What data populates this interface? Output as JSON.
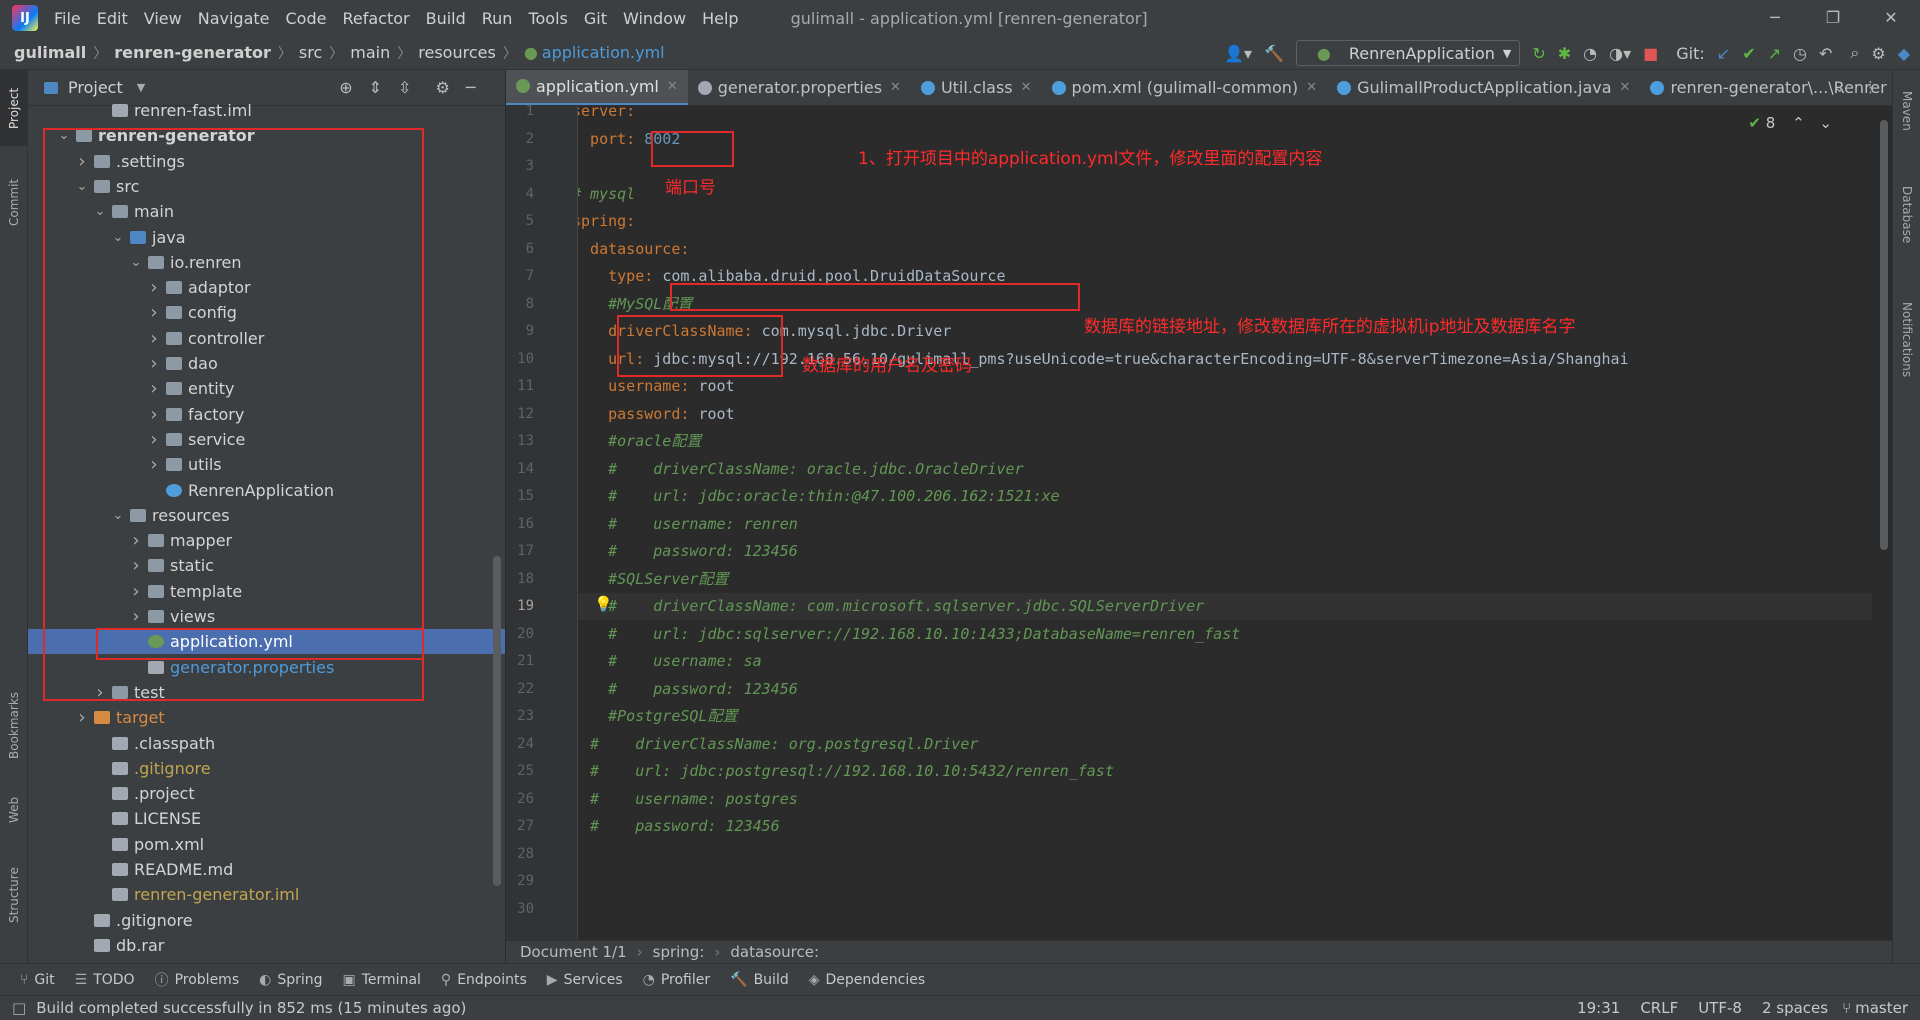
{
  "app": {
    "menu": [
      "File",
      "Edit",
      "View",
      "Navigate",
      "Code",
      "Refactor",
      "Build",
      "Run",
      "Tools",
      "Git",
      "Window",
      "Help"
    ],
    "title": "gulimall - application.yml [renren-generator]"
  },
  "breadcrumb": [
    "gulimall",
    "renren-generator",
    "src",
    "main",
    "resources",
    "application.yml"
  ],
  "toolbar": {
    "run_config": "RenrenApplication",
    "git_label": "Git:"
  },
  "left_strip": [
    "Project",
    "Commit",
    "Bookmarks",
    "Web",
    "Structure"
  ],
  "right_strip": [
    "Maven",
    "Database",
    "Notifications"
  ],
  "project_panel": {
    "title": "Project",
    "tree": [
      {
        "label": "renren-fast.iml",
        "indent": 3,
        "arrow": "",
        "icon": "file",
        "style": ""
      },
      {
        "label": "renren-generator",
        "indent": 1,
        "arrow": "v",
        "icon": "folder",
        "style": "bold"
      },
      {
        "label": ".settings",
        "indent": 2,
        "arrow": ">",
        "icon": "folder",
        "style": ""
      },
      {
        "label": "src",
        "indent": 2,
        "arrow": "v",
        "icon": "folder",
        "style": ""
      },
      {
        "label": "main",
        "indent": 3,
        "arrow": "v",
        "icon": "folder",
        "style": ""
      },
      {
        "label": "java",
        "indent": 4,
        "arrow": "v",
        "icon": "folder-blue",
        "style": ""
      },
      {
        "label": "io.renren",
        "indent": 5,
        "arrow": "v",
        "icon": "folder",
        "style": ""
      },
      {
        "label": "adaptor",
        "indent": 6,
        "arrow": ">",
        "icon": "folder",
        "style": ""
      },
      {
        "label": "config",
        "indent": 6,
        "arrow": ">",
        "icon": "folder",
        "style": ""
      },
      {
        "label": "controller",
        "indent": 6,
        "arrow": ">",
        "icon": "folder",
        "style": ""
      },
      {
        "label": "dao",
        "indent": 6,
        "arrow": ">",
        "icon": "folder",
        "style": ""
      },
      {
        "label": "entity",
        "indent": 6,
        "arrow": ">",
        "icon": "folder",
        "style": ""
      },
      {
        "label": "factory",
        "indent": 6,
        "arrow": ">",
        "icon": "folder",
        "style": ""
      },
      {
        "label": "service",
        "indent": 6,
        "arrow": ">",
        "icon": "folder",
        "style": ""
      },
      {
        "label": "utils",
        "indent": 6,
        "arrow": ">",
        "icon": "folder",
        "style": ""
      },
      {
        "label": "RenrenApplication",
        "indent": 6,
        "arrow": "",
        "icon": "class",
        "style": ""
      },
      {
        "label": "resources",
        "indent": 4,
        "arrow": "v",
        "icon": "folder",
        "style": ""
      },
      {
        "label": "mapper",
        "indent": 5,
        "arrow": ">",
        "icon": "folder",
        "style": ""
      },
      {
        "label": "static",
        "indent": 5,
        "arrow": ">",
        "icon": "folder",
        "style": ""
      },
      {
        "label": "template",
        "indent": 5,
        "arrow": ">",
        "icon": "folder",
        "style": ""
      },
      {
        "label": "views",
        "indent": 5,
        "arrow": ">",
        "icon": "folder",
        "style": ""
      },
      {
        "label": "application.yml",
        "indent": 5,
        "arrow": "",
        "icon": "leaf",
        "style": "selected"
      },
      {
        "label": "generator.properties",
        "indent": 5,
        "arrow": "",
        "icon": "file",
        "style": "blue"
      },
      {
        "label": "test",
        "indent": 3,
        "arrow": ">",
        "icon": "folder",
        "style": ""
      },
      {
        "label": "target",
        "indent": 2,
        "arrow": ">",
        "icon": "folder-orange",
        "style": "orange"
      },
      {
        "label": ".classpath",
        "indent": 3,
        "arrow": "",
        "icon": "file",
        "style": ""
      },
      {
        "label": ".gitignore",
        "indent": 3,
        "arrow": "",
        "icon": "file",
        "style": "yellow"
      },
      {
        "label": ".project",
        "indent": 3,
        "arrow": "",
        "icon": "file",
        "style": ""
      },
      {
        "label": "LICENSE",
        "indent": 3,
        "arrow": "",
        "icon": "file",
        "style": ""
      },
      {
        "label": "pom.xml",
        "indent": 3,
        "arrow": "",
        "icon": "maven",
        "style": ""
      },
      {
        "label": "README.md",
        "indent": 3,
        "arrow": "",
        "icon": "file",
        "style": ""
      },
      {
        "label": "renren-generator.iml",
        "indent": 3,
        "arrow": "",
        "icon": "file",
        "style": "yellow"
      },
      {
        "label": ".gitignore",
        "indent": 2,
        "arrow": "",
        "icon": "file",
        "style": ""
      },
      {
        "label": "db.rar",
        "indent": 2,
        "arrow": "",
        "icon": "file",
        "style": ""
      }
    ]
  },
  "tabs": [
    {
      "label": "application.yml",
      "active": true,
      "icon": "#6a9955"
    },
    {
      "label": "generator.properties",
      "active": false,
      "icon": "#a2a9b3"
    },
    {
      "label": "Util.class",
      "active": false,
      "icon": "#4e9edc"
    },
    {
      "label": "pom.xml (gulimall-common)",
      "active": false,
      "icon": "#4e9edc"
    },
    {
      "label": "GulimallProductApplication.java",
      "active": false,
      "icon": "#4e9edc"
    },
    {
      "label": "renren-generator\\...\\Renrer",
      "active": false,
      "icon": "#4e9edc"
    }
  ],
  "editor": {
    "inspection_count": "8",
    "lines": [
      [
        [
          "k",
          "server:"
        ]
      ],
      [
        [
          "k",
          "  port: "
        ],
        [
          "num",
          "8002"
        ]
      ],
      [],
      [
        [
          "c",
          "# mysql"
        ]
      ],
      [
        [
          "k",
          "spring:"
        ]
      ],
      [
        [
          "k",
          "  datasource:"
        ]
      ],
      [
        [
          "k",
          "    type: "
        ],
        [
          "v",
          "com.alibaba.druid.pool.DruidDataSource"
        ]
      ],
      [
        [
          "c",
          "    #MySQL配置"
        ]
      ],
      [
        [
          "k",
          "    driverClassName: "
        ],
        [
          "v",
          "com.mysql.jdbc.Driver"
        ]
      ],
      [
        [
          "k",
          "    url: "
        ],
        [
          "v",
          "jdbc:mysql://192.168.56.10/gulimall_pms?useUnicode=true&characterEncoding=UTF-8&serverTimezone=Asia/Shanghai"
        ]
      ],
      [
        [
          "k",
          "    username: "
        ],
        [
          "v",
          "root"
        ]
      ],
      [
        [
          "k",
          "    password: "
        ],
        [
          "v",
          "root"
        ]
      ],
      [
        [
          "c",
          "    #oracle配置"
        ]
      ],
      [
        [
          "c",
          "    #    driverClassName: oracle.jdbc.OracleDriver"
        ]
      ],
      [
        [
          "c",
          "    #    url: jdbc:oracle:thin:@47.100.206.162:1521:xe"
        ]
      ],
      [
        [
          "c",
          "    #    username: renren"
        ]
      ],
      [
        [
          "c",
          "    #    password: 123456"
        ]
      ],
      [
        [
          "c",
          "    #SQLServer配置"
        ]
      ],
      [
        [
          "c",
          "    #    driverClassName: com.microsoft.sqlserver.jdbc.SQLServerDriver"
        ]
      ],
      [
        [
          "c",
          "    #    url: jdbc:sqlserver://192.168.10.10:1433;DatabaseName=renren_fast"
        ]
      ],
      [
        [
          "c",
          "    #    username: sa"
        ]
      ],
      [
        [
          "c",
          "    #    password: 123456"
        ]
      ],
      [
        [
          "c",
          "    #PostgreSQL配置"
        ]
      ],
      [
        [
          "c",
          "  #    driverClassName: org.postgresql.Driver"
        ]
      ],
      [
        [
          "c",
          "  #    url: jdbc:postgresql://192.168.10.10:5432/renren_fast"
        ]
      ],
      [
        [
          "c",
          "  #    username: postgres"
        ]
      ],
      [
        [
          "c",
          "  #    password: 123456"
        ]
      ],
      [],
      [],
      []
    ]
  },
  "annotations": {
    "step1": "1、打开项目中的application.yml文件，修改里面的配置内容",
    "port": "端口号",
    "url": "数据库的链接地址，修改数据库所在的虚拟机ip地址及数据库名字",
    "credentials": "数据库的用户名及密码"
  },
  "editor_status": {
    "doc": "Document 1/1",
    "path": [
      "spring:",
      "datasource:"
    ]
  },
  "tool_windows": [
    "Git",
    "TODO",
    "Problems",
    "Spring",
    "Terminal",
    "Endpoints",
    "Services",
    "Profiler",
    "Build",
    "Dependencies"
  ],
  "status_bar": {
    "message": "Build completed successfully in 852 ms (15 minutes ago)",
    "position": "19:31",
    "line_sep": "CRLF",
    "encoding": "UTF-8",
    "indent": "2 spaces",
    "branch": "master"
  }
}
